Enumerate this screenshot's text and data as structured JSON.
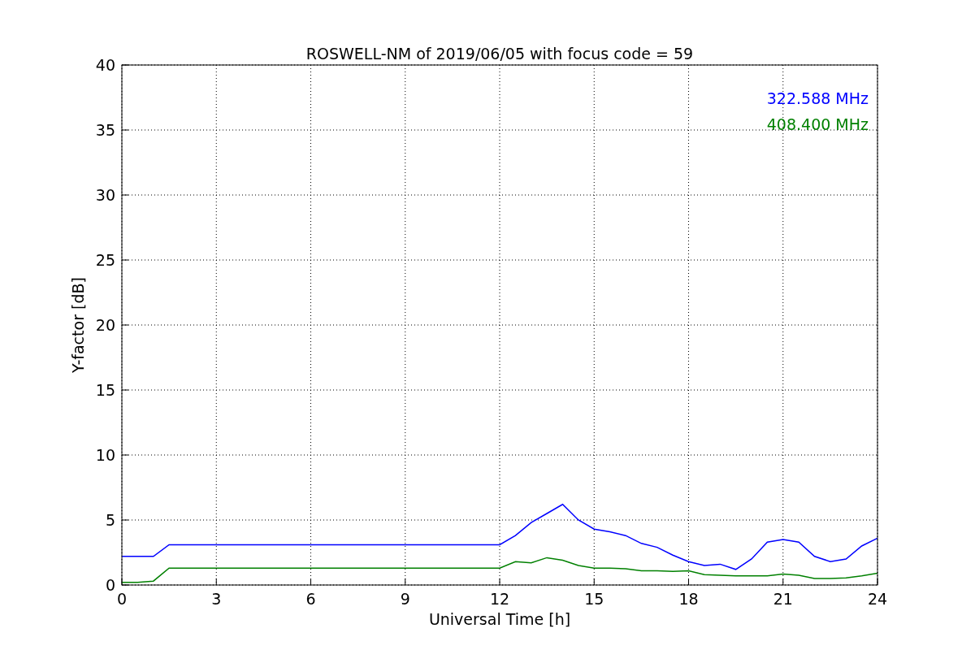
{
  "chart_data": {
    "type": "line",
    "title": "ROSWELL-NM of 2019/06/05 with focus code = 59",
    "xlabel": "Universal Time [h]",
    "ylabel": "Y-factor [dB]",
    "x": [
      0,
      0.5,
      1,
      1.5,
      2,
      2.5,
      3,
      3.5,
      4,
      4.5,
      5,
      5.5,
      6,
      6.5,
      7,
      7.5,
      8,
      8.5,
      9,
      9.5,
      10,
      10.5,
      11,
      11.5,
      12,
      12.5,
      13,
      13.5,
      14,
      14.5,
      15,
      15.5,
      16,
      16.5,
      17,
      17.5,
      18,
      18.5,
      19,
      19.5,
      20,
      20.5,
      21,
      21.5,
      22,
      22.5,
      23,
      23.5,
      24
    ],
    "series": [
      {
        "name": "322.588 MHz",
        "color": "#0000ff",
        "values": [
          2.2,
          2.2,
          2.2,
          3.1,
          3.1,
          3.1,
          3.1,
          3.1,
          3.1,
          3.1,
          3.1,
          3.1,
          3.1,
          3.1,
          3.1,
          3.1,
          3.1,
          3.1,
          3.1,
          3.1,
          3.1,
          3.1,
          3.1,
          3.1,
          3.1,
          3.8,
          4.8,
          5.5,
          6.2,
          5.0,
          4.3,
          4.1,
          3.8,
          3.2,
          2.9,
          2.3,
          1.8,
          1.5,
          1.6,
          1.2,
          2.0,
          3.3,
          3.5,
          3.3,
          2.2,
          1.8,
          2.0,
          3.0,
          3.6
        ]
      },
      {
        "name": "408.400 MHz",
        "color": "#008000",
        "values": [
          0.2,
          0.2,
          0.3,
          1.3,
          1.3,
          1.3,
          1.3,
          1.3,
          1.3,
          1.3,
          1.3,
          1.3,
          1.3,
          1.3,
          1.3,
          1.3,
          1.3,
          1.3,
          1.3,
          1.3,
          1.3,
          1.3,
          1.3,
          1.3,
          1.3,
          1.8,
          1.7,
          2.1,
          1.9,
          1.5,
          1.3,
          1.3,
          1.25,
          1.1,
          1.1,
          1.05,
          1.1,
          0.8,
          0.75,
          0.7,
          0.7,
          0.7,
          0.85,
          0.75,
          0.5,
          0.5,
          0.55,
          0.7,
          0.9
        ]
      }
    ],
    "xlim": [
      0,
      24
    ],
    "ylim": [
      0,
      40
    ],
    "xticks": [
      0,
      3,
      6,
      9,
      12,
      15,
      18,
      21,
      24
    ],
    "yticks": [
      0,
      5,
      10,
      15,
      20,
      25,
      30,
      35,
      40
    ],
    "grid": true
  }
}
